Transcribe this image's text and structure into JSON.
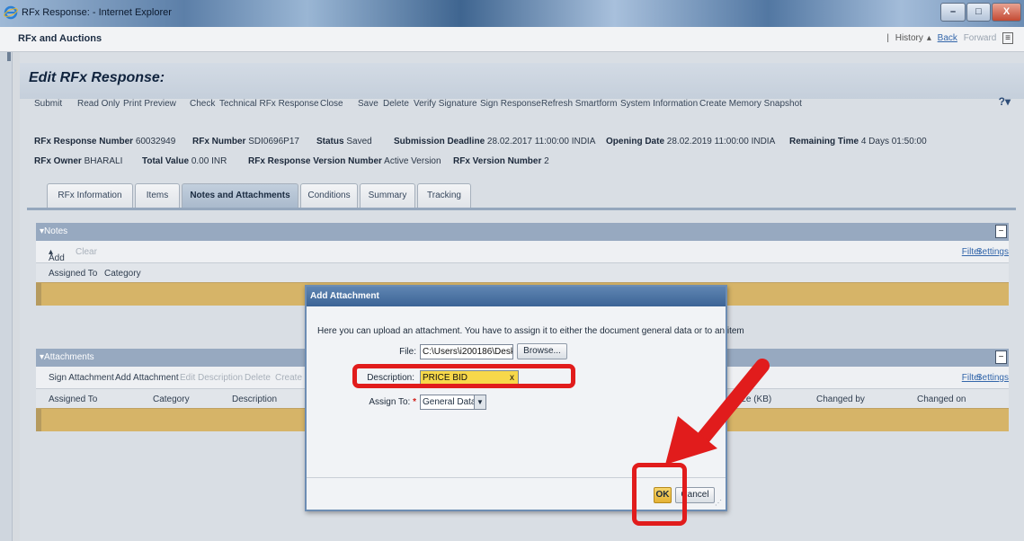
{
  "window": {
    "title": "RFx Response: - Internet Explorer",
    "min": "–",
    "max": "□",
    "close": "X"
  },
  "appbar": {
    "title": "RFx and Auctions",
    "history": "History",
    "back": "Back",
    "forward": "Forward"
  },
  "page": {
    "title": "Edit RFx Response:"
  },
  "toolbar": {
    "items": [
      "Submit",
      "Read Only",
      "Print Preview",
      "Check",
      "Technical RFx Response",
      "Close",
      "Save",
      "Delete",
      "Verify Signature",
      "Sign Response",
      "Refresh Smartform",
      "System Information",
      "Create Memory Snapshot"
    ],
    "help": "?"
  },
  "info": {
    "response_number_label": "RFx Response Number",
    "response_number": "60032949",
    "rfx_number_label": "RFx Number",
    "rfx_number": "SDI0696P17",
    "status_label": "Status",
    "status": "Saved",
    "deadline_label": "Submission Deadline",
    "deadline": "28.02.2017 11:00:00 INDIA",
    "opening_label": "Opening Date",
    "opening": "28.02.2019 11:00:00 INDIA",
    "remaining_label": "Remaining Time",
    "remaining": "4 Days 01:50:00",
    "owner_label": "RFx Owner",
    "owner": "BHARALI",
    "total_label": "Total Value",
    "total": "0.00 INR",
    "version_label": "RFx Response Version Number",
    "version": "Active Version",
    "rfx_version_label": "RFx Version Number",
    "rfx_version": "2"
  },
  "tabs": [
    "RFx Information",
    "Items",
    "Notes and Attachments",
    "Conditions",
    "Summary",
    "Tracking"
  ],
  "notes": {
    "title": "Notes",
    "add": "Add",
    "clear": "Clear",
    "filter": "Filter",
    "settings": "Settings",
    "col_assigned": "Assigned To",
    "col_category": "Category"
  },
  "attachments": {
    "title": "Attachments",
    "sign": "Sign Attachment",
    "add": "Add Attachment",
    "edit_desc": "Edit Description",
    "delete": "Delete",
    "create": "Create",
    "filter": "Filter",
    "settings": "Settings",
    "col_assigned": "Assigned To",
    "col_category": "Category",
    "col_description": "Description",
    "col_size": "Size (KB)",
    "col_changed_by": "Changed by",
    "col_changed_on": "Changed on"
  },
  "dialog": {
    "title": "Add Attachment",
    "intro": "Here you can upload an attachment. You have to assign it to either the document general data or to an item",
    "file_label": "File:",
    "file_value": "C:\\Users\\i200186\\Deskt",
    "browse": "Browse...",
    "desc_label": "Description:",
    "desc_value": "PRICE BID",
    "desc_clear": "x",
    "assign_label": "Assign To:",
    "assign_value": "General Data",
    "ok": "OK",
    "cancel": "Cancel"
  },
  "colors": {
    "highlight": "#e11c1c",
    "row_fill": "#d6b468",
    "section_head": "#97a9c0"
  }
}
